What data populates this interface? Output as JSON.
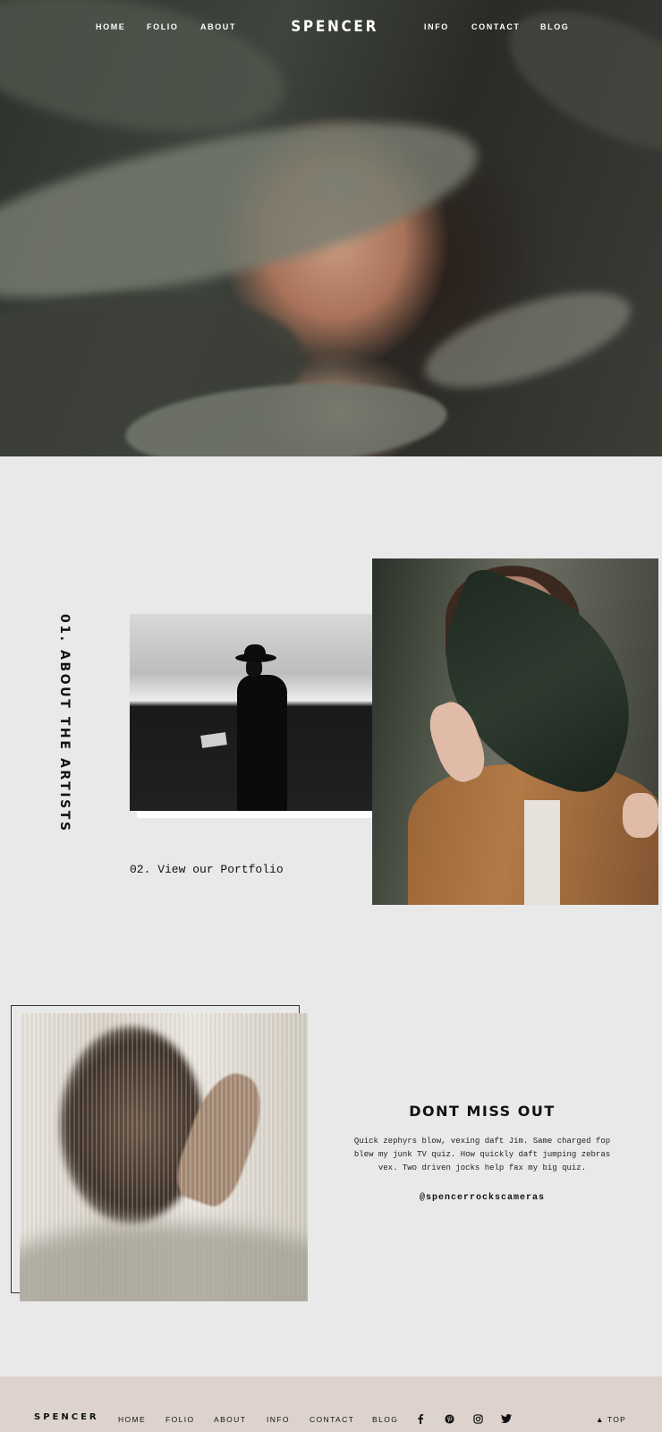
{
  "nav": {
    "left": [
      "HOME",
      "FOLIO",
      "ABOUT"
    ],
    "logo": "SPENCER",
    "right": [
      "INFO",
      "CONTACT",
      "BLOG"
    ]
  },
  "about": {
    "title": "01. ABOUT THE ARTISTS",
    "portfolio_link": "02. View our Portfolio"
  },
  "promo": {
    "title": "DONT MISS OUT",
    "body": "Quick zephyrs blow, vexing daft Jim. Same charged fop blew my junk TV quiz. How quickly daft jumping zebras vex. Two driven jocks help fax my big quiz.",
    "handle": "@spencerrockscameras"
  },
  "footer": {
    "logo": "SPENCER",
    "links": [
      "HOME",
      "FOLIO",
      "ABOUT",
      "INFO",
      "CONTACT",
      "BLOG"
    ],
    "social_icons": [
      "facebook-icon",
      "pinterest-icon",
      "instagram-icon",
      "twitter-icon"
    ],
    "top_label": "TOP"
  },
  "colors": {
    "background": "#e9e9e9",
    "footer_bg": "#ddd3cc",
    "text": "#111111"
  }
}
